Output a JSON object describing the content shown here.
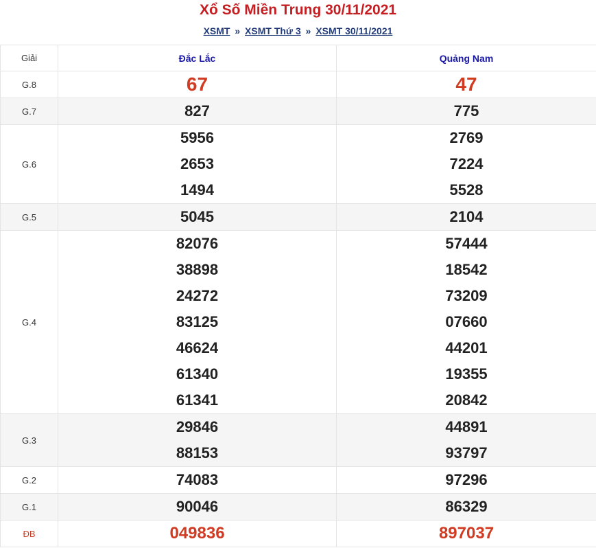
{
  "title": "Xổ Số Miền Trung 30/11/2021",
  "breadcrumb": {
    "items": [
      "XSMT",
      "XSMT Thứ 3",
      "XSMT 30/11/2021"
    ],
    "separator": "»"
  },
  "table": {
    "header": {
      "giai": "Giải",
      "provinces": [
        "Đắc Lắc",
        "Quảng Nam"
      ]
    },
    "rows": [
      {
        "label": "G.8",
        "col1": [
          "67"
        ],
        "col2": [
          "47"
        ]
      },
      {
        "label": "G.7",
        "col1": [
          "827"
        ],
        "col2": [
          "775"
        ]
      },
      {
        "label": "G.6",
        "col1": [
          "5956",
          "2653",
          "1494"
        ],
        "col2": [
          "2769",
          "7224",
          "5528"
        ]
      },
      {
        "label": "G.5",
        "col1": [
          "5045"
        ],
        "col2": [
          "2104"
        ]
      },
      {
        "label": "G.4",
        "col1": [
          "82076",
          "38898",
          "24272",
          "83125",
          "46624",
          "61340",
          "61341"
        ],
        "col2": [
          "57444",
          "18542",
          "73209",
          "07660",
          "44201",
          "19355",
          "20842"
        ]
      },
      {
        "label": "G.3",
        "col1": [
          "29846",
          "88153"
        ],
        "col2": [
          "44891",
          "93797"
        ]
      },
      {
        "label": "G.2",
        "col1": [
          "74083"
        ],
        "col2": [
          "97296"
        ]
      },
      {
        "label": "G.1",
        "col1": [
          "90046"
        ],
        "col2": [
          "86329"
        ]
      },
      {
        "label": "ĐB",
        "col1": [
          "049836"
        ],
        "col2": [
          "897037"
        ]
      }
    ]
  },
  "colors": {
    "title": "#c51e22",
    "link": "#243e7a",
    "header_province": "#1a1aa6",
    "highlight_red": "#d13b22",
    "alt_row_bg": "#f5f5f5"
  }
}
